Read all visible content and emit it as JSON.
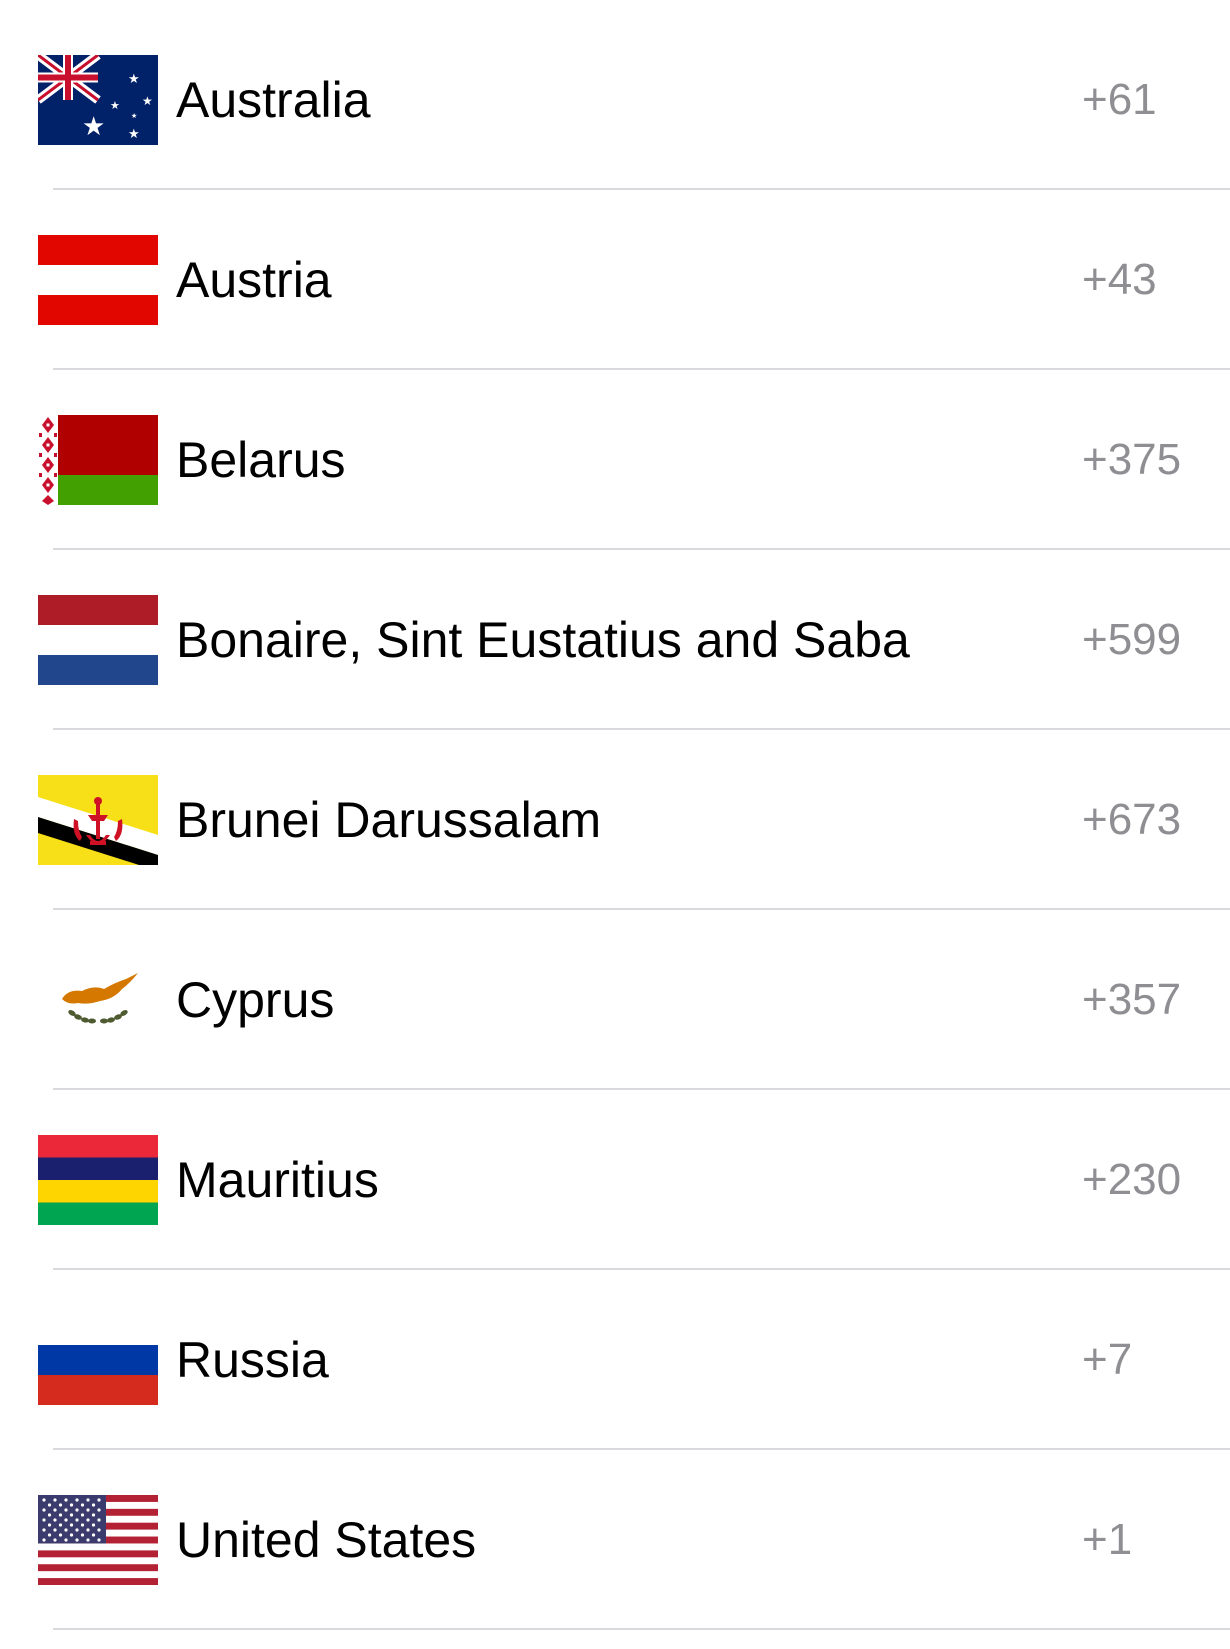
{
  "countries": [
    {
      "name": "Australia",
      "code": "+61",
      "flag_icon": "australia-flag-icon"
    },
    {
      "name": "Austria",
      "code": "+43",
      "flag_icon": "austria-flag-icon"
    },
    {
      "name": "Belarus",
      "code": "+375",
      "flag_icon": "belarus-flag-icon"
    },
    {
      "name": "Bonaire, Sint Eustatius and Saba",
      "code": "+599",
      "flag_icon": "netherlands-flag-icon"
    },
    {
      "name": "Brunei Darussalam",
      "code": "+673",
      "flag_icon": "brunei-flag-icon"
    },
    {
      "name": "Cyprus",
      "code": "+357",
      "flag_icon": "cyprus-flag-icon"
    },
    {
      "name": "Mauritius",
      "code": "+230",
      "flag_icon": "mauritius-flag-icon"
    },
    {
      "name": "Russia",
      "code": "+7",
      "flag_icon": "russia-flag-icon"
    },
    {
      "name": "United States",
      "code": "+1",
      "flag_icon": "united-states-flag-icon"
    }
  ],
  "colors": {
    "name_text": "#000000",
    "code_text": "#8e8e93",
    "separator": "#d9d9de"
  }
}
